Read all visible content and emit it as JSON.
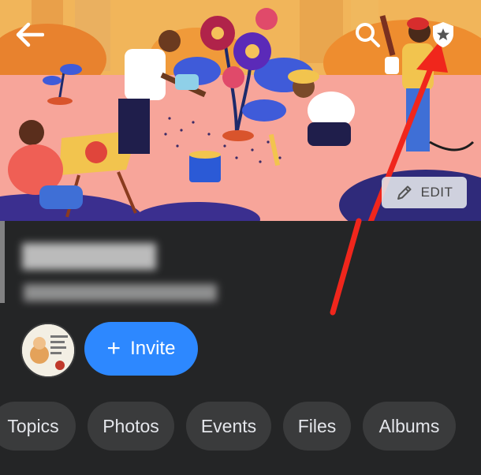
{
  "header": {
    "back_icon": "arrow-left-icon",
    "search_icon": "search-icon",
    "admin_icon": "shield-star-icon"
  },
  "cover": {
    "edit_label": "EDIT",
    "edit_icon": "pencil-icon"
  },
  "actions": {
    "invite_label": "Invite",
    "invite_icon": "plus-icon"
  },
  "tabs": [
    {
      "label": "Topics"
    },
    {
      "label": "Photos"
    },
    {
      "label": "Events"
    },
    {
      "label": "Files"
    },
    {
      "label": "Albums"
    }
  ],
  "colors": {
    "background": "#242526",
    "accent": "#2d88ff",
    "tab_bg": "#3a3b3c",
    "arrow": "#f0261c"
  }
}
